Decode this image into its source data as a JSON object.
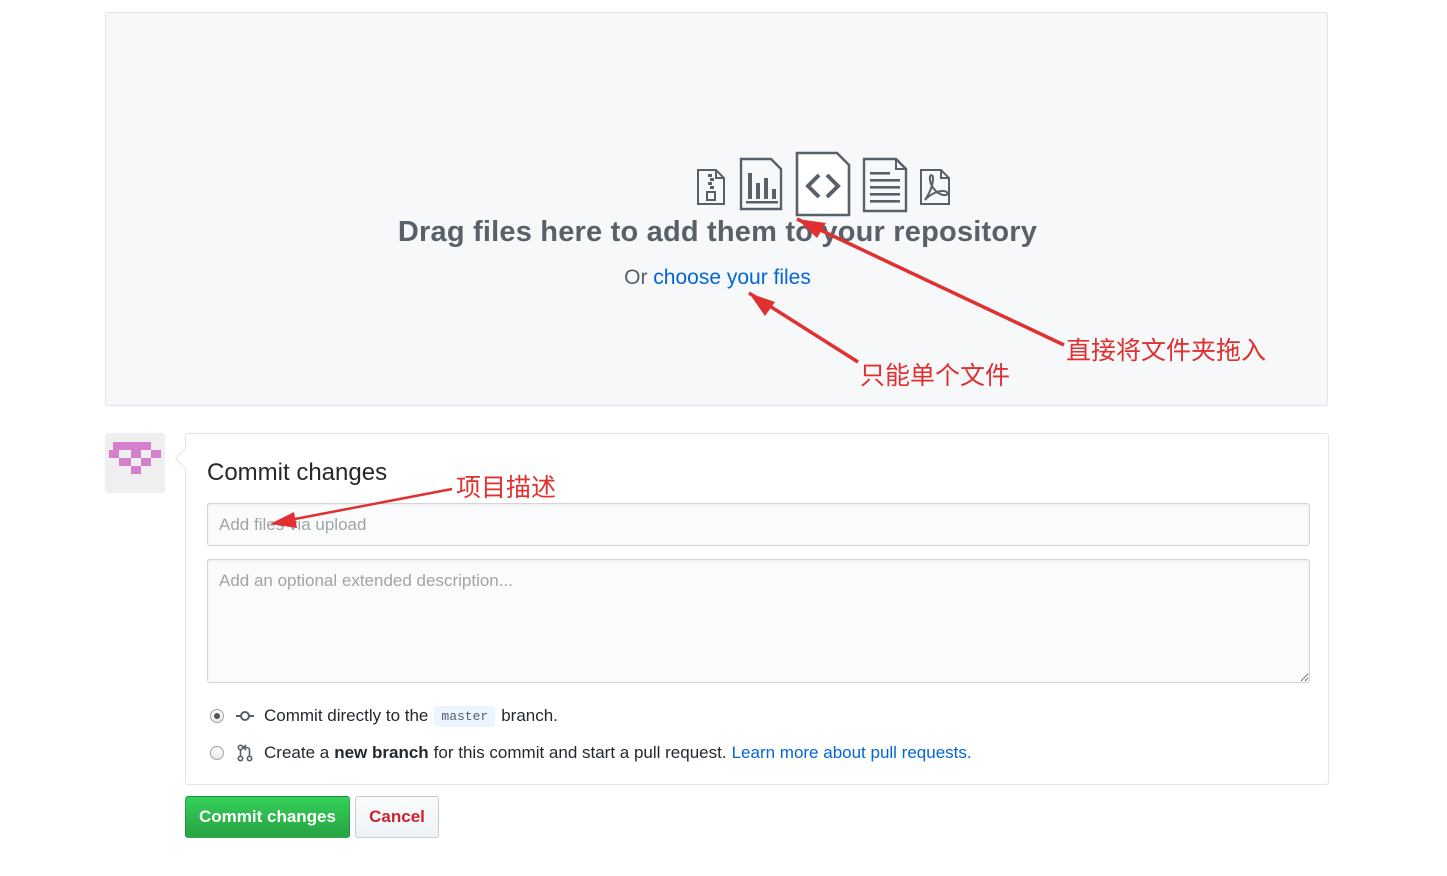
{
  "dropzone": {
    "title": "Drag files here to add them to your repository",
    "or_text": "Or",
    "choose_link": "choose your files",
    "icons": [
      "file-zip-icon",
      "graph-icon",
      "file-code-icon",
      "file-text-icon",
      "file-pdf-icon"
    ]
  },
  "commit": {
    "title": "Commit changes",
    "summary_placeholder": "Add files via upload",
    "description_placeholder": "Add an optional extended description...",
    "option_direct": {
      "prefix": "Commit directly to the",
      "branch": "master",
      "suffix": "branch.",
      "checked": true
    },
    "option_new_branch": {
      "prefix": "Create a",
      "bold": "new branch",
      "suffix": "for this commit and start a pull request.",
      "link": "Learn more about pull requests.",
      "checked": false
    }
  },
  "buttons": {
    "commit": "Commit changes",
    "cancel": "Cancel"
  },
  "annotations": {
    "drag_folder": "直接将文件夹拖入",
    "single_file": "只能单个文件",
    "project_desc": "项目描述",
    "color": "#e03030"
  },
  "colors": {
    "link": "#0366d6",
    "commit_button": "#28a745",
    "cancel_text": "#cb2431",
    "avatar": "#d57fcd"
  }
}
